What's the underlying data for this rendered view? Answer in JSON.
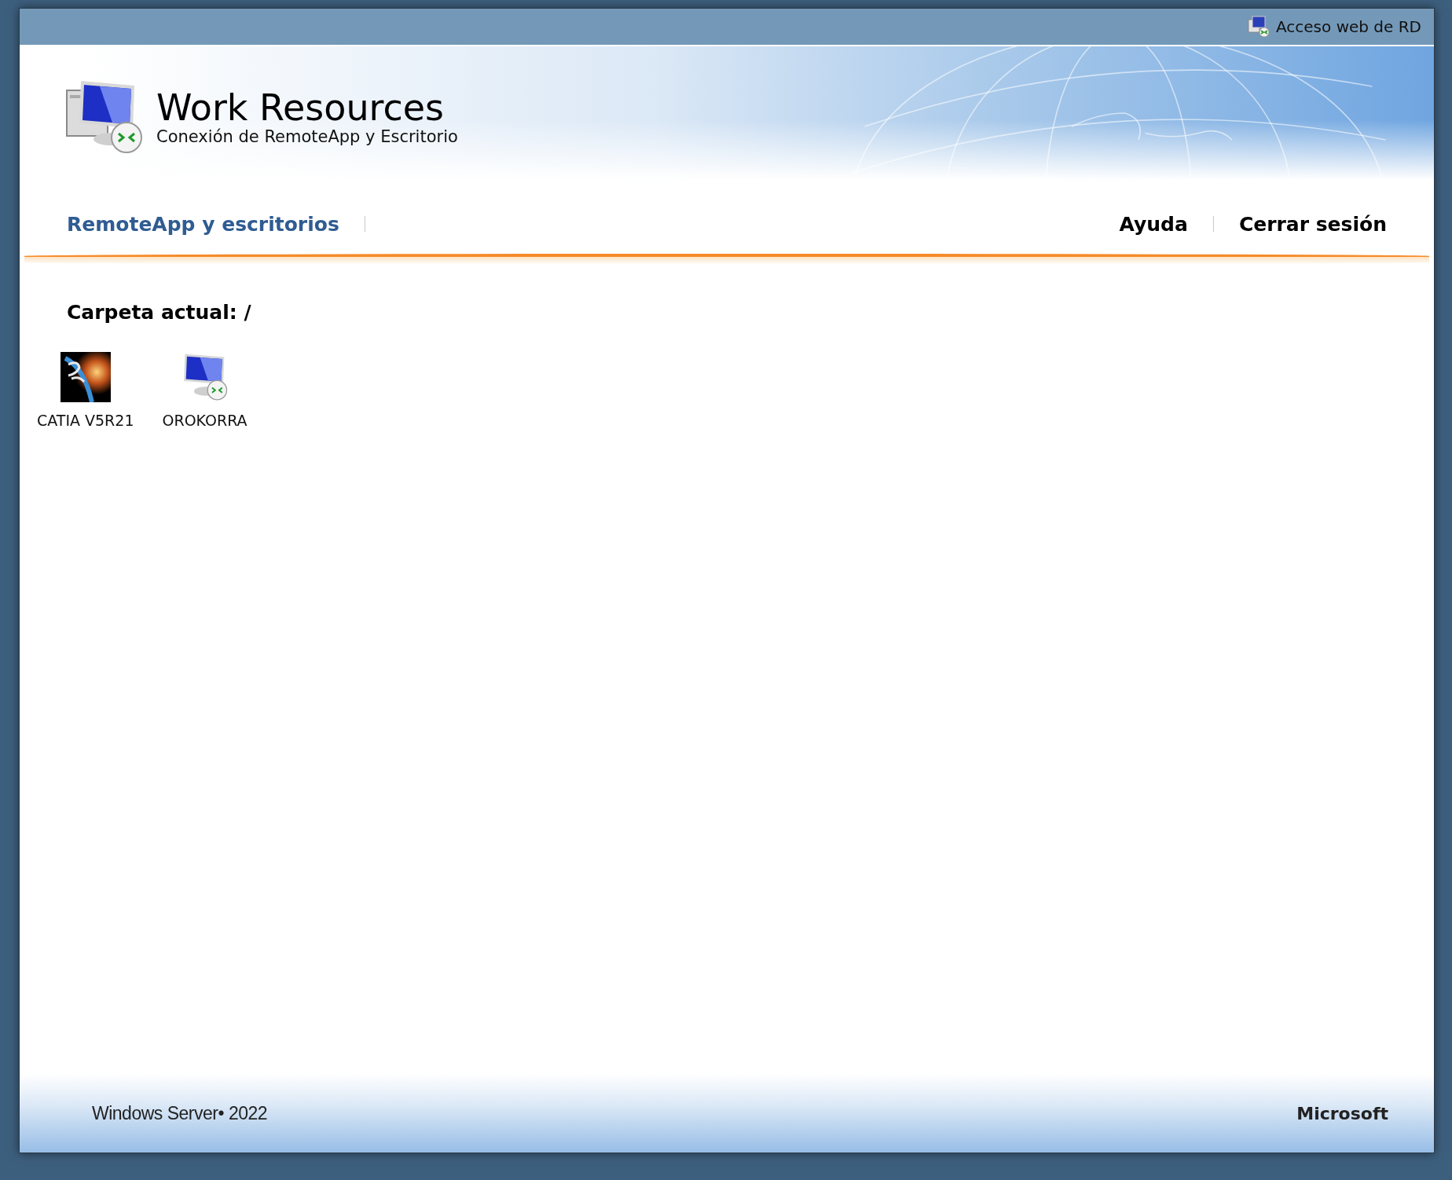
{
  "top_bar": {
    "label": "Acceso web de RD"
  },
  "header": {
    "title": "Work Resources",
    "subtitle": "Conexión de RemoteApp y Escritorio"
  },
  "nav": {
    "left": [
      {
        "label": "RemoteApp y escritorios",
        "selected": true
      }
    ],
    "right": [
      {
        "label": "Ayuda",
        "selected": false
      },
      {
        "label": "Cerrar sesión",
        "selected": false
      }
    ]
  },
  "folder": {
    "label": "Carpeta actual: /"
  },
  "resources": [
    {
      "kind": "app",
      "name": "CATIA V5R21"
    },
    {
      "kind": "desktop",
      "name": "OROKORRA"
    }
  ],
  "footer": {
    "product": "Windows Server• 2022",
    "brand": "Microsoft"
  }
}
